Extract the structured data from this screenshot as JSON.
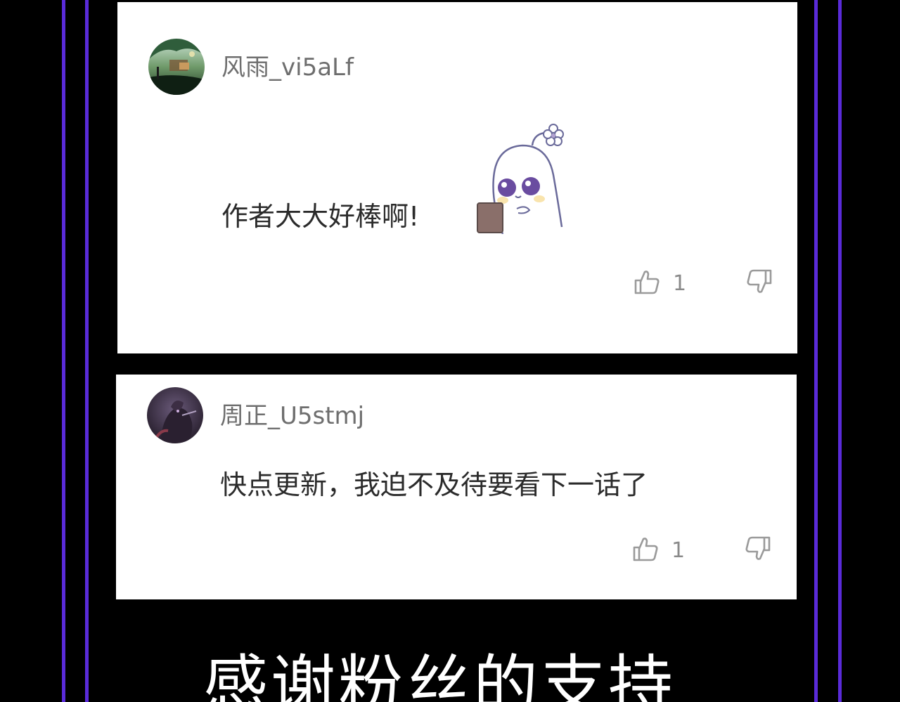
{
  "colors": {
    "background": "#000000",
    "accent_lines": "#5a2bd9",
    "card": "#ffffff",
    "username": "#6e6e6e",
    "comment_text": "#2b2b2b",
    "icon": "#9a9a9a"
  },
  "comments": [
    {
      "username": "风雨_vi5aLf",
      "text": "作者大大好棒啊!",
      "sticker": "ghost-sticker",
      "likes": "1"
    },
    {
      "username": "周正_U5stmj",
      "text": "快点更新，我迫不及待要看下一话了",
      "likes": "1"
    }
  ],
  "footer": {
    "text": "感谢粉丝的支持"
  }
}
